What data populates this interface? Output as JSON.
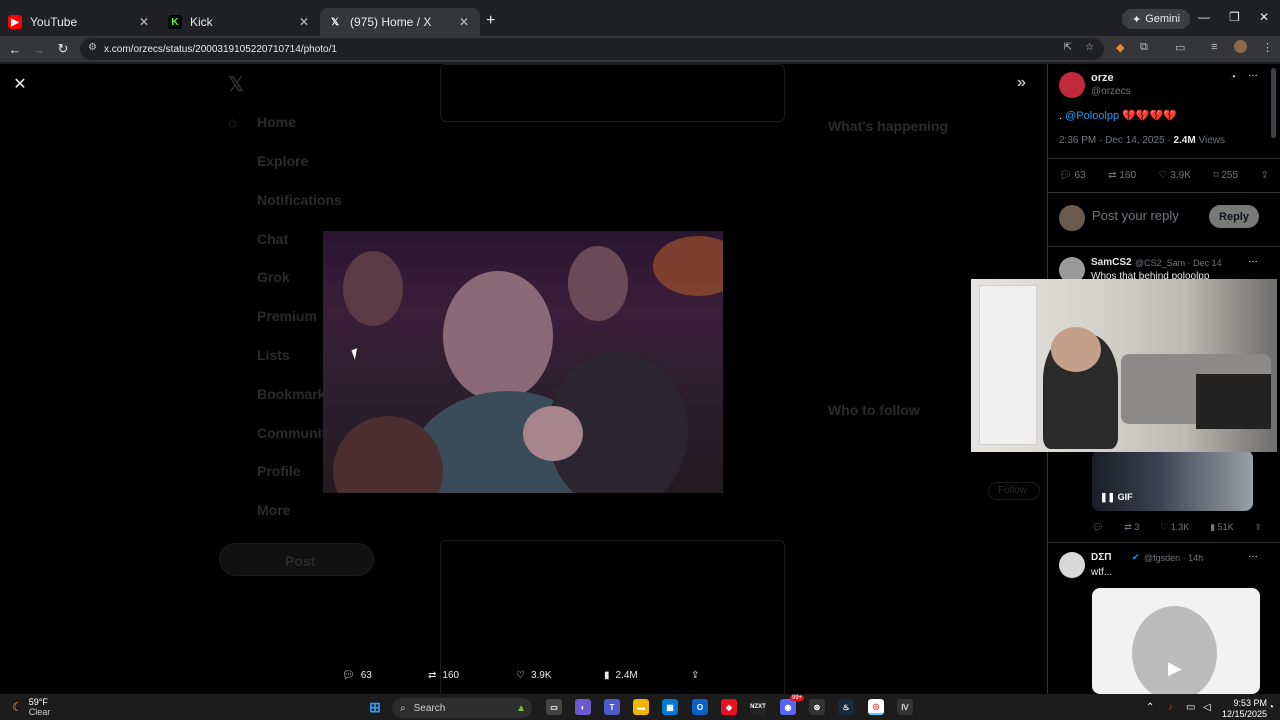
{
  "browser": {
    "tabs": [
      {
        "title": "YouTube",
        "favicon": "youtube-icon",
        "color": "#ff0000"
      },
      {
        "title": "Kick",
        "favicon": "kick-icon",
        "color": "#53fc18"
      },
      {
        "title": "(975) Home / X",
        "favicon": "x-icon",
        "color": "#ffffff"
      }
    ],
    "gemini_label": "Gemini",
    "url": "x.com/orzecs/status/2000319105220710714/photo/1"
  },
  "background_layout": {
    "sidebar_items": [
      "Home",
      "Explore",
      "Notifications",
      "Chat",
      "Grok",
      "Premium",
      "Lists",
      "Bookmarks",
      "Communities",
      "Profile",
      "More"
    ],
    "post_button": "Post",
    "trends_title": "What's happening",
    "follow_title": "Who to follow",
    "follow_button": "Follow"
  },
  "viewer": {
    "stats": {
      "replies": "63",
      "reposts": "160",
      "likes": "3.9K",
      "views": "2.4M"
    }
  },
  "post": {
    "author_name": "orze",
    "author_handle": "@orzecs",
    "mention": "@Poloolpp",
    "text_prefix": ".",
    "hearts": "💔💔💔💔",
    "time": "2:36 PM · Dec 14, 2025 · ",
    "views": "2.4M",
    "views_label": " Views",
    "replies": "63",
    "reposts": "160",
    "likes": "3.9K",
    "bookmarks": "255",
    "reply_placeholder": "Post your reply",
    "reply_button": "Reply"
  },
  "replies": [
    {
      "name": "SamCS2",
      "handle": "@CS2_Sam · Dec 14",
      "text": "Whos that behind poloolpp",
      "gif_label": "GIF",
      "stats": {
        "replies": "",
        "reposts": "3",
        "likes": "1.3K",
        "views": "51K"
      }
    },
    {
      "name": "DΣΠ",
      "handle": "@fgsden · 14h",
      "text": "wtf..."
    }
  ],
  "taskbar": {
    "temperature": "59°F",
    "condition": "Clear",
    "search_label": "Search",
    "time": "9:53 PM",
    "date": "12/15/2025",
    "badge": "99+"
  }
}
